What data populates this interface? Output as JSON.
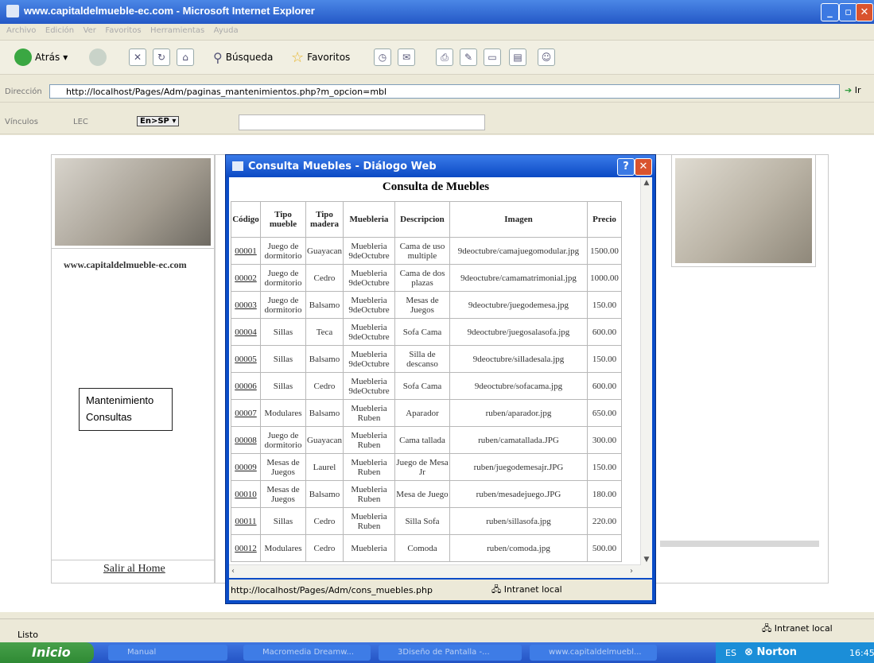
{
  "window": {
    "title": "www.capitaldelmueble-ec.com - Microsoft Internet Explorer"
  },
  "menu": [
    "Archivo",
    "Edición",
    "Ver",
    "Favoritos",
    "Herramientas",
    "Ayuda"
  ],
  "toolbar": {
    "back": "Atrás",
    "search": "Búsqueda",
    "favorites": "Favoritos"
  },
  "address": {
    "label": "Dirección",
    "url": "http://localhost/Pages/Adm/paginas_mantenimientos.php?m_opcion=mbl",
    "go": "Ir"
  },
  "links": {
    "label": "Vínculos",
    "lec": "LEC",
    "translate": "En>SP ▾"
  },
  "page": {
    "site_name": "www.capitaldelmueble-ec.com",
    "menu_items": [
      "Mantenimiento",
      "Consultas"
    ],
    "exit_link": "Salir al Home"
  },
  "dialog": {
    "title": "Consulta Muebles - Diálogo Web",
    "heading": "Consulta de Muebles",
    "headers": [
      "Código",
      "Tipo mueble",
      "Tipo madera",
      "Muebleria",
      "Descripcion",
      "Imagen",
      "Precio"
    ],
    "rows": [
      [
        "00001",
        "Juego de dormitorio",
        "Guayacan",
        "Muebleria 9deOctubre",
        "Cama de uso multiple",
        "9deoctubre/camajuegomodular.jpg",
        "1500.00"
      ],
      [
        "00002",
        "Juego de dormitorio",
        "Cedro",
        "Muebleria 9deOctubre",
        "Cama de dos plazas",
        "9deoctubre/camamatrimonial.jpg",
        "1000.00"
      ],
      [
        "00003",
        "Juego de dormitorio",
        "Balsamo",
        "Muebleria 9deOctubre",
        "Mesas de Juegos",
        "9deoctubre/juegodemesa.jpg",
        "150.00"
      ],
      [
        "00004",
        "Sillas",
        "Teca",
        "Muebleria 9deOctubre",
        "Sofa Cama",
        "9deoctubre/juegosalasofa.jpg",
        "600.00"
      ],
      [
        "00005",
        "Sillas",
        "Balsamo",
        "Muebleria 9deOctubre",
        "Silla de descanso",
        "9deoctubre/silladesala.jpg",
        "150.00"
      ],
      [
        "00006",
        "Sillas",
        "Cedro",
        "Muebleria 9deOctubre",
        "Sofa Cama",
        "9deoctubre/sofacama.jpg",
        "600.00"
      ],
      [
        "00007",
        "Modulares",
        "Balsamo",
        "Muebleria Ruben",
        "Aparador",
        "ruben/aparador.jpg",
        "650.00"
      ],
      [
        "00008",
        "Juego de dormitorio",
        "Guayacan",
        "Muebleria Ruben",
        "Cama tallada",
        "ruben/camatallada.JPG",
        "300.00"
      ],
      [
        "00009",
        "Mesas de Juegos",
        "Laurel",
        "Muebleria Ruben",
        "Juego de Mesa Jr",
        "ruben/juegodemesajr.JPG",
        "150.00"
      ],
      [
        "00010",
        "Mesas de Juegos",
        "Balsamo",
        "Muebleria Ruben",
        "Mesa de Juego",
        "ruben/mesadejuego.JPG",
        "180.00"
      ],
      [
        "00011",
        "Sillas",
        "Cedro",
        "Muebleria Ruben",
        "Silla Sofa",
        "ruben/sillasofa.jpg",
        "220.00"
      ],
      [
        "00012",
        "Modulares",
        "Cedro",
        "Muebleria",
        "Comoda",
        "ruben/comoda.jpg",
        "500.00"
      ]
    ],
    "status_url": "http://localhost/Pages/Adm/cons_muebles.php",
    "status_zone": "Intranet local"
  },
  "statusbar": {
    "left": "Listo",
    "zone": "Intranet local"
  },
  "taskbar": {
    "start": "Inicio",
    "tasks": [
      "Manual",
      "Macromedia Dreamw...",
      "3Diseño de Pantalla -...",
      "www.capitaldelmuebl..."
    ],
    "tray_lang": "ES",
    "tray_app": "Norton",
    "clock": "16:45"
  }
}
